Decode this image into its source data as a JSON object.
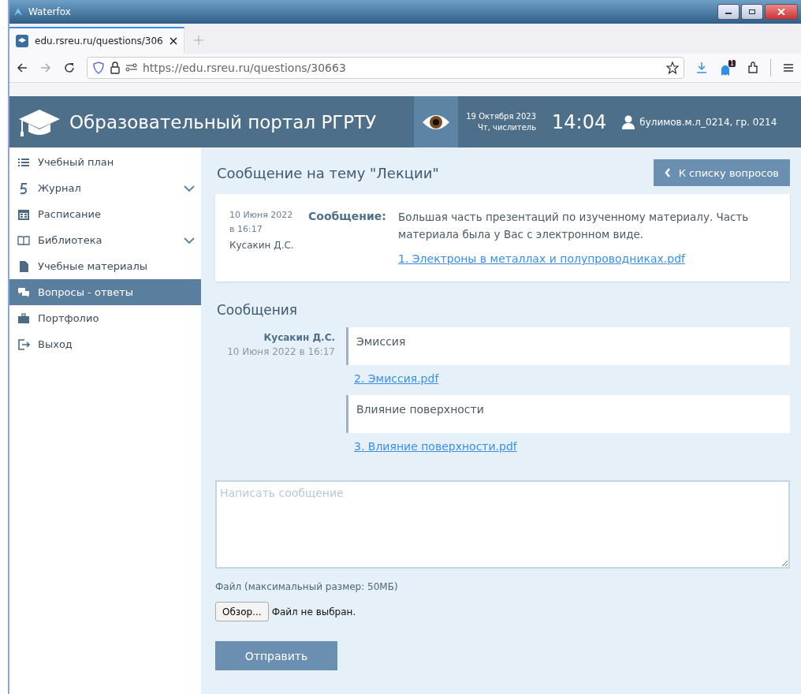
{
  "window": {
    "title": "Waterfox"
  },
  "browser": {
    "tabs": [
      {
        "label": "edu.rsreu.ru/questions/306",
        "selected": true
      }
    ],
    "url": "https://edu.rsreu.ru/questions/30663",
    "extension_badge": "1"
  },
  "header": {
    "title": "Образовательный портал РГРТУ",
    "date": "19 Октября 2023",
    "week": "Чт, числитель",
    "time": "14:04",
    "user": "булимов.м.л_0214, гр. 0214"
  },
  "sidebar": {
    "items": [
      {
        "label": "Учебный план",
        "has_submenu": false,
        "selected": false
      },
      {
        "label": "Журнал",
        "has_submenu": true,
        "selected": false
      },
      {
        "label": "Расписание",
        "has_submenu": false,
        "selected": false
      },
      {
        "label": "Библиотека",
        "has_submenu": true,
        "selected": false
      },
      {
        "label": "Учебные материалы",
        "has_submenu": false,
        "selected": false
      },
      {
        "label": "Вопросы - ответы",
        "has_submenu": false,
        "selected": true
      },
      {
        "label": "Портфолио",
        "has_submenu": false,
        "selected": false
      },
      {
        "label": "Выход",
        "has_submenu": false,
        "selected": false
      }
    ]
  },
  "topic": {
    "title": "Сообщение на тему \"Лекции\"",
    "back_button": "К списку вопросов",
    "date": "10 Июня 2022",
    "time": "в 16:17",
    "author": "Кусакин Д.С.",
    "label": "Сообщение:",
    "text": "Большая часть презентаций по изученному материалу. Часть материала была у Вас с электронном виде.",
    "attachment": "1. Электроны в металлах и полупроводниках.pdf"
  },
  "messages": {
    "title": "Сообщения",
    "author": "Кусакин Д.С.",
    "datetime": "10 Июня 2022 в 16:17",
    "items": [
      {
        "text": "Эмиссия",
        "attachment": "2. Эмиссия.pdf"
      },
      {
        "text": "Влияние поверхности",
        "attachment": "3. Влияние поверхности.pdf"
      }
    ]
  },
  "form": {
    "placeholder": "Написать сообщение",
    "file_label": "Файл (максимальный размер: 50МБ)",
    "browse_button": "Обзор...",
    "file_status": "Файл не выбран.",
    "submit_button": "Отправить"
  }
}
